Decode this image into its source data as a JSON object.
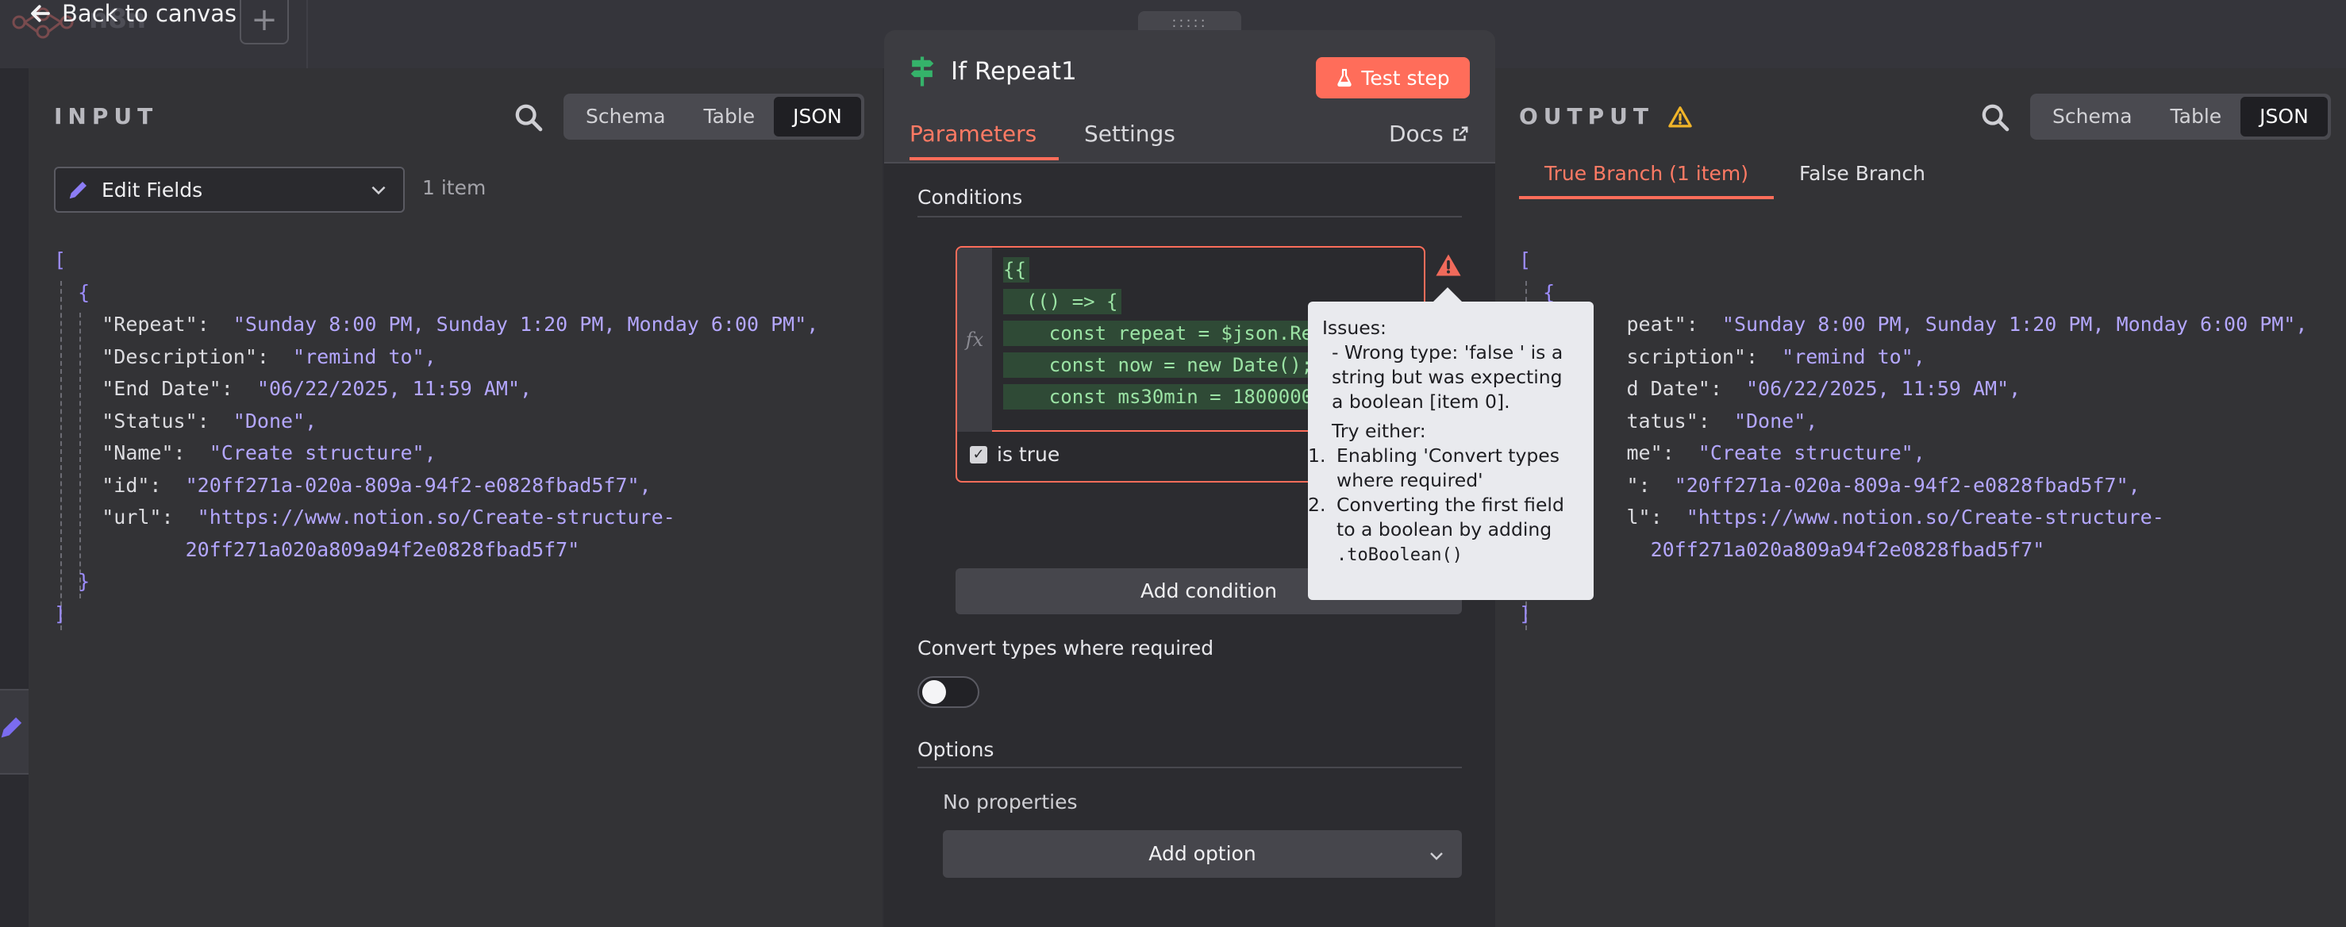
{
  "topbar": {
    "back_label": "Back to canvas",
    "ghost_title": "n8n",
    "add_symbol": "+"
  },
  "input_panel": {
    "title": "INPUT",
    "view_tabs": [
      "Schema",
      "Table",
      "JSON"
    ],
    "active_view": "JSON",
    "node_select": "Edit Fields",
    "item_count": "1 item"
  },
  "output_panel": {
    "title": "OUTPUT",
    "view_tabs": [
      "Schema",
      "Table",
      "JSON"
    ],
    "active_view": "JSON",
    "branch_tabs": [
      "True Branch (1 item)",
      "False Branch"
    ],
    "active_branch": "True Branch (1 item)"
  },
  "json_item": {
    "open_bracket": "[",
    "open_brace": "{",
    "close_brace": "}",
    "close_bracket": "]",
    "fields": [
      {
        "key": "\"Repeat\":",
        "value": "\"Sunday 8:00 PM, Sunday 1:20 PM, Monday 6:00 PM\","
      },
      {
        "key": "\"Description\":",
        "value": "\"remind to\","
      },
      {
        "key": "\"End Date\":",
        "value": "\"06/22/2025, 11:59 AM\","
      },
      {
        "key": "\"Status\":",
        "value": "\"Done\","
      },
      {
        "key": "\"Name\":",
        "value": "\"Create structure\","
      },
      {
        "key": "\"id\":",
        "value": "\"20ff271a-020a-809a-94f2-e0828fbad5f7\","
      },
      {
        "key": "\"url\":",
        "value": "\"https://www.notion.so/Create-structure-",
        "value_cont": "20ff271a020a809a94f2e0828fbad5f7\""
      }
    ],
    "output_fields_visible": [
      {
        "key": "peat\":",
        "value": "\"Sunday 8:00 PM, Sunday 1:20 PM, Monday 6:00 PM\","
      },
      {
        "key": "scription\":",
        "value": "\"remind to\","
      },
      {
        "key": "d Date\":",
        "value": "\"06/22/2025, 11:59 AM\","
      },
      {
        "key": "tatus\":",
        "value": "\"Done\","
      },
      {
        "key": "me\":",
        "value": "\"Create structure\","
      },
      {
        "key": "\":",
        "value": "\"20ff271a-020a-809a-94f2-e0828fbad5f7\","
      },
      {
        "key": "l\":",
        "value": "\"https://www.notion.so/Create-structure-",
        "value_cont": "20ff271a020a809a94f2e0828fbad5f7\""
      }
    ]
  },
  "node": {
    "grip": ":::::",
    "name": "If Repeat1",
    "test_button": "Test step",
    "tabs": [
      "Parameters",
      "Settings"
    ],
    "active_tab": "Parameters",
    "docs_label": "Docs",
    "conditions_label": "Conditions",
    "fx_label": "fx",
    "code_lines": [
      "{{",
      "  (() => {",
      "    const repeat = $json.Re",
      "    const now = new Date();",
      "    const ms30min = 1800000"
    ],
    "operator_label": "is true",
    "add_condition": "Add condition",
    "convert_label": "Convert types where required",
    "convert_enabled": false,
    "options_label": "Options",
    "no_properties": "No properties",
    "add_option": "Add option"
  },
  "tooltip": {
    "issues_title": "Issues:",
    "issue_text": "- Wrong type: 'false ' is a string but was expecting a boolean [item 0].",
    "try_label": "Try either:",
    "options": [
      {
        "num": "1.",
        "text": "Enabling 'Convert types where required'"
      },
      {
        "num": "2.",
        "text": "Converting the first field to a boolean by adding",
        "code": ".toBoolean()"
      }
    ]
  },
  "colors": {
    "accent": "#ff6d5a",
    "string_value": "#b4a7ff",
    "code_text": "#9be3a4",
    "warning": "#f0b429"
  }
}
